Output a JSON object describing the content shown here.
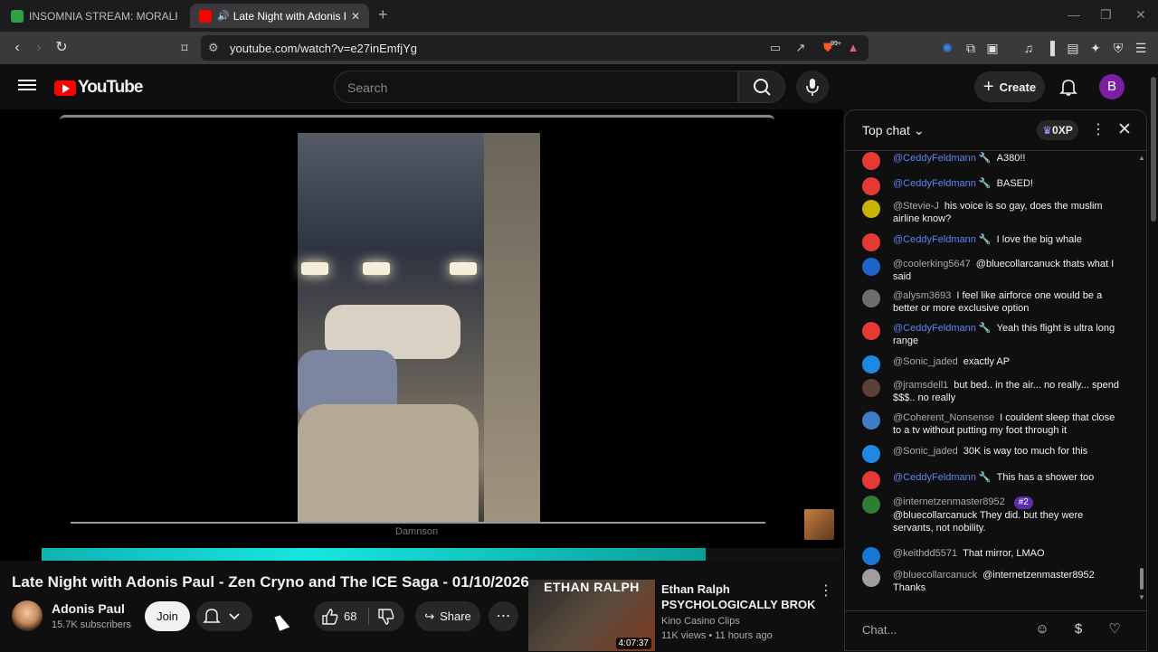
{
  "browser": {
    "tabs": [
      {
        "title": "INSOMNIA STREAM: MORALFAG ED",
        "active": false
      },
      {
        "title": "Late Night with Adonis Paul -",
        "active": true
      }
    ],
    "url": "youtube.com/watch?v=e27inEmfjYg",
    "ext_badge": "99+"
  },
  "header": {
    "logo": "YouTube",
    "search_placeholder": "Search",
    "create_label": "Create",
    "avatar_letter": "B"
  },
  "player": {
    "watermark": "Damnson",
    "progress": 0.828
  },
  "video": {
    "title": "Late Night with Adonis Paul - Zen Cryno and The ICE Saga - 01/10/2026",
    "channel": "Adonis Paul",
    "subscribers": "15.7K subscribers",
    "join_label": "Join",
    "likes": "68",
    "share_label": "Share"
  },
  "recommended": {
    "thumb_banner": "ETHAN RALPH",
    "duration": "4:07:37",
    "channel_line": "Ethan Ralph",
    "title": "PSYCHOLOGICALLY BROKEN ...",
    "uploader": "Kino Casino Clips",
    "meta": "11K views • 11 hours ago"
  },
  "chat": {
    "mode_label": "Top chat",
    "xp_label": "0XP",
    "input_placeholder": "Chat...",
    "messages": [
      {
        "author": "@CeddyFeldmann 🔧",
        "text": "A380!!",
        "mod": true,
        "avatar_color": "#e53935"
      },
      {
        "author": "@CeddyFeldmann 🔧",
        "text": "BASED!",
        "mod": true,
        "avatar_color": "#e53935"
      },
      {
        "author": "@Stevie-J",
        "text": "his voice is so gay, does the muslim airline know?",
        "mod": false,
        "avatar_color": "#c8b400"
      },
      {
        "author": "@CeddyFeldmann 🔧",
        "text": "I love the big whale",
        "mod": true,
        "avatar_color": "#e53935"
      },
      {
        "author": "@coolerking5647",
        "text": "@bluecollarcanuck thats what I said",
        "mod": false,
        "avatar_color": "#1e64c8"
      },
      {
        "author": "@alysm3693",
        "text": "I feel like airforce one would be a better or more exclusive option",
        "mod": false,
        "avatar_color": "#6d6d6d"
      },
      {
        "author": "@CeddyFeldmann 🔧",
        "text": "Yeah this flight is ultra long range",
        "mod": true,
        "avatar_color": "#e53935"
      },
      {
        "author": "@Sonic_jaded",
        "text": "exactly AP",
        "mod": false,
        "avatar_color": "#1e88e5"
      },
      {
        "author": "@jramsdell1",
        "text": "but bed.. in the air... no really... spend $$$.. no really",
        "mod": false,
        "avatar_color": "#5d4037"
      },
      {
        "author": "@Coherent_Nonsense",
        "text": "I couldent sleep that close to a tv without putting my foot through it",
        "mod": false,
        "avatar_color": "#3f7cc7"
      },
      {
        "author": "@Sonic_jaded",
        "text": "30K is way too much for this",
        "mod": false,
        "avatar_color": "#1e88e5"
      },
      {
        "author": "@CeddyFeldmann 🔧",
        "text": "This has a shower too",
        "mod": true,
        "avatar_color": "#e53935"
      },
      {
        "author": "@internetzenmaster8952",
        "badge": "#2",
        "text": "@bluecollarcanuck They did. but they were servants, not nobility.",
        "mod": false,
        "avatar_color": "#2e7d32"
      },
      {
        "author": "@keithdd5571",
        "text": "That mirror, LMAO",
        "mod": false,
        "avatar_color": "#1976d2"
      },
      {
        "author": "@bluecollarcanuck",
        "text": "@internetzenmaster8952 Thanks",
        "mod": false,
        "avatar_color": "#9e9e9e"
      }
    ]
  },
  "colors": {
    "accent": "#ff0000",
    "progress": "#17e6e0",
    "mod_name": "#5e84f1"
  }
}
